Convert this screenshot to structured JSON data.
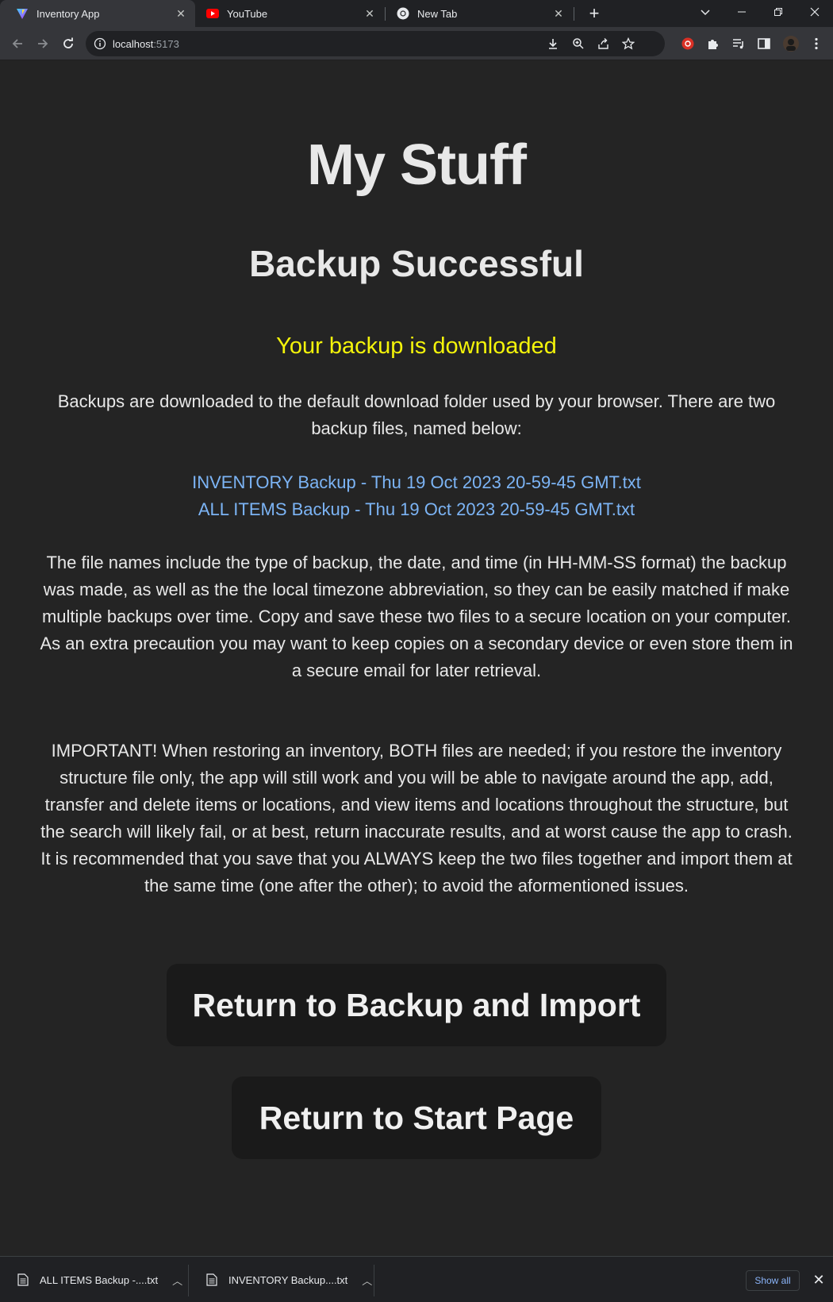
{
  "browser": {
    "tabs": [
      {
        "label": "Inventory App",
        "icon": "vite-icon",
        "active": true
      },
      {
        "label": "YouTube",
        "icon": "youtube-icon",
        "active": false
      },
      {
        "label": "New Tab",
        "icon": "chrome-icon",
        "active": false
      }
    ],
    "url_host": "localhost",
    "url_port": ":5173"
  },
  "page": {
    "title": "My Stuff",
    "heading": "Backup Successful",
    "notice": "Your backup is downloaded",
    "intro": "Backups are downloaded to the default download folder used by your browser. There are two backup files, named below:",
    "files": [
      "INVENTORY Backup - Thu 19 Oct 2023 20-59-45 GMT.txt",
      "ALL ITEMS Backup - Thu 19 Oct 2023 20-59-45 GMT.txt"
    ],
    "explanation": "The file names include the type of backup, the date, and time (in HH-MM-SS format) the backup was made, as well as the the local timezone abbreviation, so they can be easily matched if make multiple backups over time. Copy and save these two files to a secure location on your computer. As an extra precaution you may want to keep copies on a secondary device or even store them in a secure email for later retrieval.",
    "important": "IMPORTANT! When restoring an inventory, BOTH files are needed; if you restore the inventory structure file only, the app will still work and you will be able to navigate around the app, add, transfer and delete items or locations, and view items and locations throughout the structure, but the search will likely fail, or at best, return inaccurate results, and at worst cause the app to crash. It is recommended that you save that you ALWAYS keep the two files together and import them at the same time (one after the other); to avoid the aformentioned issues.",
    "buttons": {
      "backup_import": "Return to Backup and Import",
      "start_page": "Return to Start Page"
    }
  },
  "downloads": {
    "items": [
      "ALL ITEMS Backup -....txt",
      "INVENTORY Backup....txt"
    ],
    "show_all": "Show all"
  },
  "colors": {
    "page_bg": "#242424",
    "notice": "#f4f40a",
    "link": "#7cb4f5",
    "button_bg": "#1a1a1a"
  }
}
